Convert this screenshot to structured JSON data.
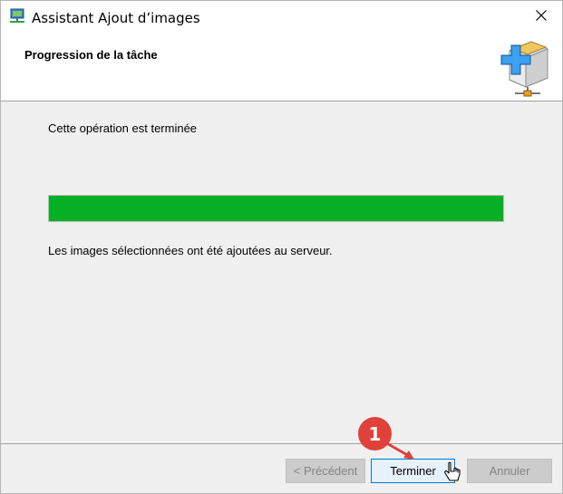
{
  "window": {
    "title": "Assistant Ajout d’images",
    "icon": "monitor-network-icon",
    "close_icon": "close-icon"
  },
  "header": {
    "title": "Progression de la tâche",
    "icon": "box-add-network-icon"
  },
  "main": {
    "status_label": "Cette opération est terminée",
    "progress_percent": 100,
    "progress_color": "#06b025",
    "result_text": "Les images sélectionnées ont été ajoutées au serveur."
  },
  "footer": {
    "prev_label": "< Précédent",
    "finish_label": "Terminer",
    "cancel_label": "Annuler"
  },
  "annotation": {
    "step_number": "1",
    "badge_color": "#e0413a"
  }
}
